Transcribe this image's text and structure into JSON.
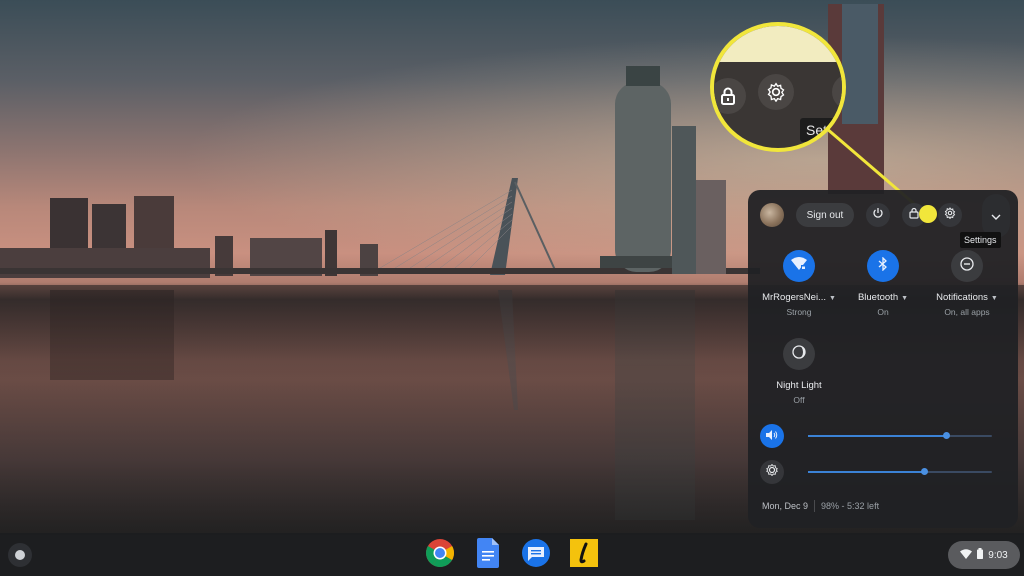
{
  "magnifier": {
    "tooltip_text": "Setti",
    "buttons": [
      "lock-icon",
      "gear-icon",
      "chevron-down-icon"
    ],
    "highlight_color": "#f1e63b"
  },
  "tray": {
    "sign_out_label": "Sign out",
    "top_buttons": [
      "power-icon",
      "lock-icon",
      "gear-icon",
      "chevron-down-icon"
    ],
    "settings_tooltip": "Settings",
    "features": [
      {
        "label": "MrRogersNei...",
        "status": "Strong",
        "icon": "wifi-icon",
        "active": true,
        "has_dropdown": true
      },
      {
        "label": "Bluetooth",
        "status": "On",
        "icon": "bluetooth-icon",
        "active": true,
        "has_dropdown": true
      },
      {
        "label": "Notifications",
        "status": "On, all apps",
        "icon": "do-not-disturb-icon",
        "active": false,
        "has_dropdown": true
      },
      {
        "label": "Night Light",
        "status": "Off",
        "icon": "night-light-icon",
        "active": false,
        "has_dropdown": false
      }
    ],
    "volume": {
      "icon": "volume-icon",
      "level_percent": 75
    },
    "brightness": {
      "icon": "brightness-icon",
      "level_percent": 63
    },
    "date": "Mon, Dec 9",
    "battery_text": "98% - 5:32 left",
    "accent_color": "#1a73e8"
  },
  "shelf": {
    "launcher_icon": "launcher-icon",
    "apps": [
      {
        "name": "Chrome",
        "icon": "chrome-icon"
      },
      {
        "name": "Google Docs",
        "icon": "docs-icon"
      },
      {
        "name": "Messages",
        "icon": "messages-icon"
      },
      {
        "name": "Lexis",
        "icon": "l-app-icon"
      }
    ],
    "status": {
      "time": "9:03",
      "icons": [
        "wifi-icon",
        "battery-icon"
      ]
    }
  }
}
